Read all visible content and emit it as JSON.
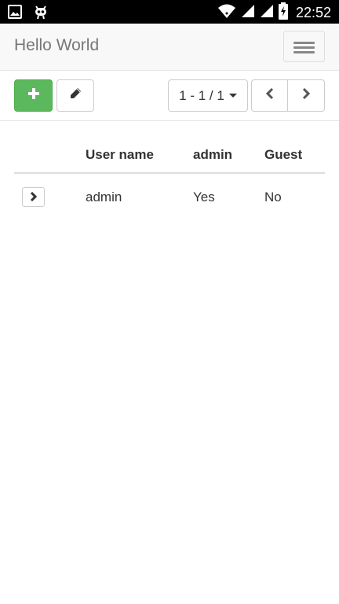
{
  "status_bar": {
    "time": "22:52",
    "icons": [
      "image-icon",
      "robot-icon",
      "wifi-icon",
      "signal-icon",
      "signal-icon",
      "battery-charging-icon"
    ]
  },
  "navbar": {
    "brand": "Hello World",
    "toggle_icon": "hamburger-menu-icon"
  },
  "toolbar": {
    "add_icon": "plus-icon",
    "edit_icon": "pencil-icon",
    "pager_label": "1 - 1 / 1",
    "prev_icon": "chevron-left-icon",
    "next_icon": "chevron-right-icon"
  },
  "table": {
    "columns": [
      "",
      "User name",
      "admin",
      "Guest"
    ],
    "rows": [
      {
        "expand_icon": "chevron-right-icon",
        "user_name": "admin",
        "admin": "Yes",
        "guest": "No"
      }
    ]
  },
  "colors": {
    "add_button": "#5cb85c",
    "navbar_bg": "#f8f8f8",
    "status_bar_bg": "#000000"
  }
}
